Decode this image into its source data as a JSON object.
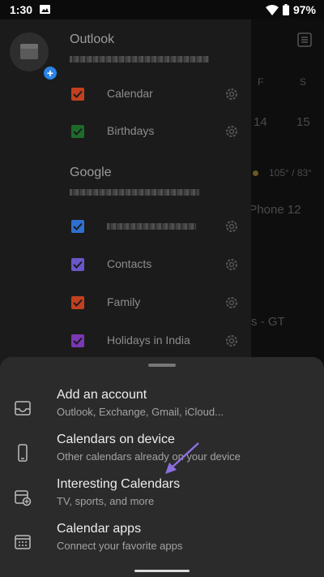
{
  "status_bar": {
    "time": "1:30",
    "battery": "97%"
  },
  "background_calendar": {
    "day_headers": [
      "F",
      "S"
    ],
    "dates": [
      "14",
      "15"
    ],
    "weather": "105° / 83°",
    "event_1": "iPhone 12",
    "event_2": "s - GT"
  },
  "drawer": {
    "accounts": [
      {
        "name": "Outlook",
        "calendars": [
          {
            "label": "Calendar",
            "color": "#c2401f"
          },
          {
            "label": "Birthdays",
            "color": "#1d6b2a"
          }
        ]
      },
      {
        "name": "Google",
        "calendars": [
          {
            "label": "",
            "color": "#2f6fd0"
          },
          {
            "label": "Contacts",
            "color": "#6a55c9"
          },
          {
            "label": "Family",
            "color": "#c2401f"
          },
          {
            "label": "Holidays in India",
            "color": "#7a37b6"
          }
        ]
      }
    ]
  },
  "sheet": {
    "options": [
      {
        "title": "Add an account",
        "subtitle": "Outlook, Exchange, Gmail, iCloud..."
      },
      {
        "title": "Calendars on device",
        "subtitle": "Other calendars already on your device"
      },
      {
        "title": "Interesting Calendars",
        "subtitle": "TV, sports, and more"
      },
      {
        "title": "Calendar apps",
        "subtitle": "Connect your favorite apps"
      }
    ]
  },
  "colors": {
    "accent_blue": "#2b83e8",
    "arrow": "#8b6fe0"
  }
}
